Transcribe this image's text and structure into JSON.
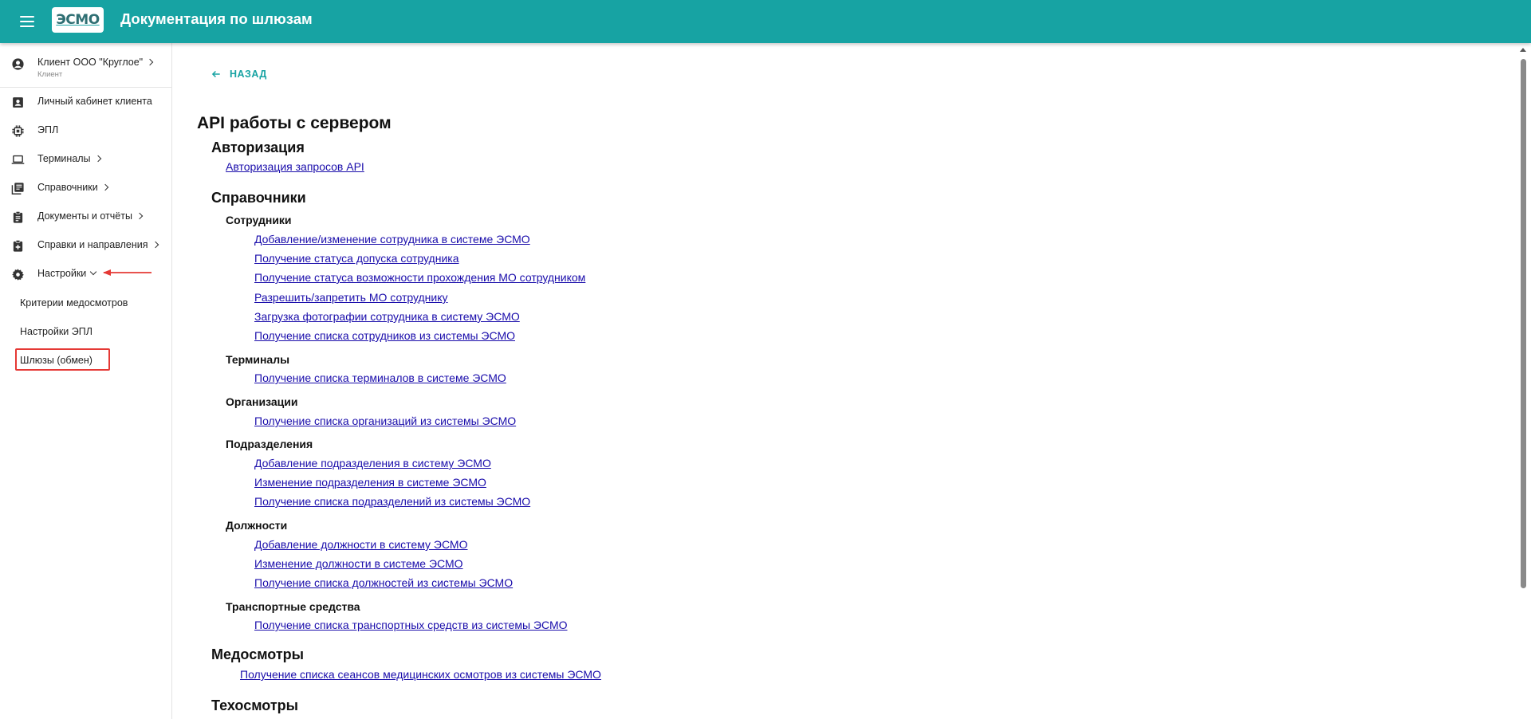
{
  "app": {
    "title": "Документация по шлюзам",
    "logo": "ЭСМО",
    "accent": "#17a3a3"
  },
  "sidebar": {
    "client": {
      "name": "Клиент ООО \"Круглое\"",
      "role": "Клиент"
    },
    "items": [
      {
        "label": "Личный кабинет клиента",
        "icon": "id-card-icon"
      },
      {
        "label": "ЭПЛ",
        "icon": "chip-icon"
      },
      {
        "label": "Терминалы",
        "icon": "laptop-icon",
        "expandable": true
      },
      {
        "label": "Справочники",
        "icon": "library-books-icon",
        "expandable": true
      },
      {
        "label": "Документы и отчёты",
        "icon": "clipboard-icon",
        "expandable": true
      },
      {
        "label": "Справки и направления",
        "icon": "medical-clipboard-icon",
        "expandable": true
      },
      {
        "label": "Настройки",
        "icon": "gear-icon",
        "expanded": true
      }
    ],
    "subitems": [
      {
        "label": "Критерии медосмотров"
      },
      {
        "label": "Настройки ЭПЛ"
      },
      {
        "label": "Шлюзы (обмен)",
        "active": true
      }
    ]
  },
  "main": {
    "back_label": "НАЗАД",
    "title": "API работы с сервером",
    "sections": {
      "auth": {
        "title": "Авторизация",
        "links": [
          "Авторизация запросов API"
        ]
      },
      "refs": {
        "title": "Справочники",
        "employees": {
          "title": "Сотрудники",
          "links": [
            "Добавление/изменение сотрудника в системе ЭСМО",
            "Получение статуса допуска сотрудника",
            "Получение статуса возможности прохождения МО сотрудником",
            "Разрешить/запретить МО сотруднику",
            "Загрузка фотографии сотрудника в систему ЭСМО",
            "Получение списка сотрудников из системы ЭСМО"
          ]
        },
        "terminals": {
          "title": "Терминалы",
          "links": [
            "Получение списка терминалов в системе ЭСМО"
          ]
        },
        "orgs": {
          "title": "Организации",
          "links": [
            "Получение списка организаций из системы ЭСМО"
          ]
        },
        "divisions": {
          "title": "Подразделения",
          "links": [
            "Добавление подразделения в систему ЭСМО",
            "Изменение подразделения в системе ЭСМО",
            "Получение списка подразделений из системы ЭСМО"
          ]
        },
        "positions": {
          "title": "Должности",
          "links": [
            "Добавление должности в систему ЭСМО",
            "Изменение должности в системе ЭСМО",
            "Получение списка должностей из системы ЭСМО"
          ]
        },
        "vehicles": {
          "title": "Транспортные средства",
          "links": [
            "Получение списка транспортных средств из системы ЭСМО"
          ]
        }
      },
      "medchecks": {
        "title": "Медосмотры",
        "links": [
          "Получение списка сеансов медицинских осмотров из системы ЭСМО"
        ]
      },
      "techchecks": {
        "title": "Техосмотры"
      }
    }
  }
}
